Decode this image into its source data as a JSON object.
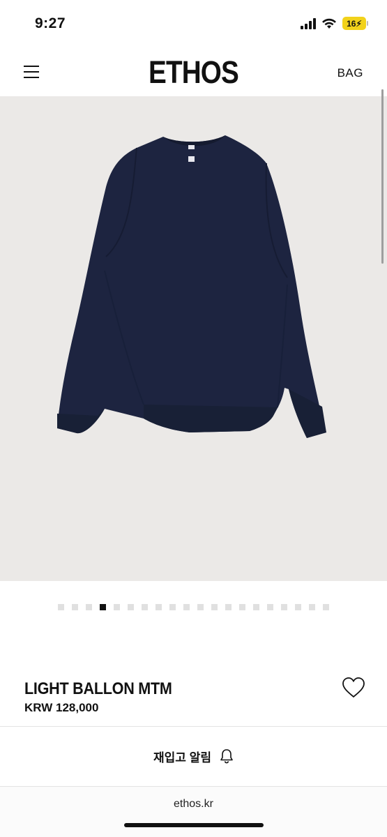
{
  "status_bar": {
    "time": "9:27",
    "battery": "16",
    "icons": [
      "cellular-signal-icon",
      "wifi-icon",
      "battery-icon"
    ]
  },
  "header": {
    "menu_icon": "hamburger-menu-icon",
    "logo": "ETHOS",
    "bag_label": "BAG"
  },
  "product_image": {
    "background_color": "#ebe9e7",
    "garment_color": "#1d2440",
    "current_index": 4,
    "total": 20
  },
  "product": {
    "name": "LIGHT BALLON MTM",
    "price": "KRW 128,000",
    "wishlist_icon": "heart-outline-icon"
  },
  "restock": {
    "label": "재입고 알림",
    "icon": "bell-icon"
  },
  "browser": {
    "url": "ethos.kr"
  }
}
